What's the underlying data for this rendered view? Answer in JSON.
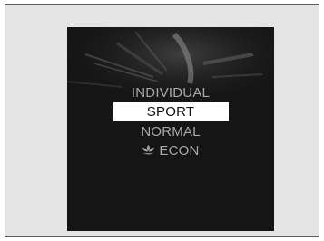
{
  "drive_mode_menu": {
    "items": [
      {
        "label": "INDIVIDUAL",
        "selected": false
      },
      {
        "label": "SPORT",
        "selected": true
      },
      {
        "label": "NORMAL",
        "selected": false
      },
      {
        "label": "ECON",
        "selected": false,
        "icon": "econ-leaf-icon"
      }
    ]
  },
  "colors": {
    "screen_background": "#151515",
    "highlight": "#ffffff",
    "text_inactive": "#a8a8a8",
    "panel_background": "#e4e4e4"
  }
}
